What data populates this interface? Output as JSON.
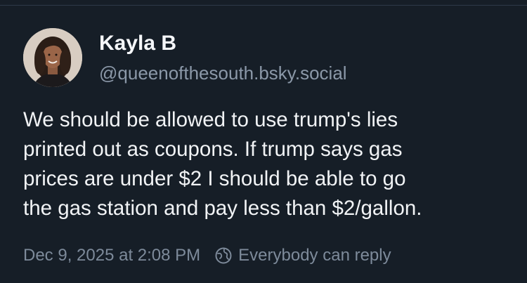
{
  "author": {
    "display_name": "Kayla B",
    "handle": "@queenofthesouth.bsky.social"
  },
  "post": {
    "lines": [
      "We should be allowed to use trump's lies",
      "printed out as coupons. If trump says gas",
      "prices are under $2 I should be able to go",
      "the gas station and pay less than $2/gallon."
    ],
    "timestamp": "Dec 9, 2025 at 2:08 PM",
    "reply_setting": "Everybody can reply"
  },
  "icons": {
    "reply_setting_icon": "globe-icon"
  },
  "colors": {
    "background": "#161e27",
    "text": "#f1f3f5",
    "muted": "#8b98a8"
  }
}
